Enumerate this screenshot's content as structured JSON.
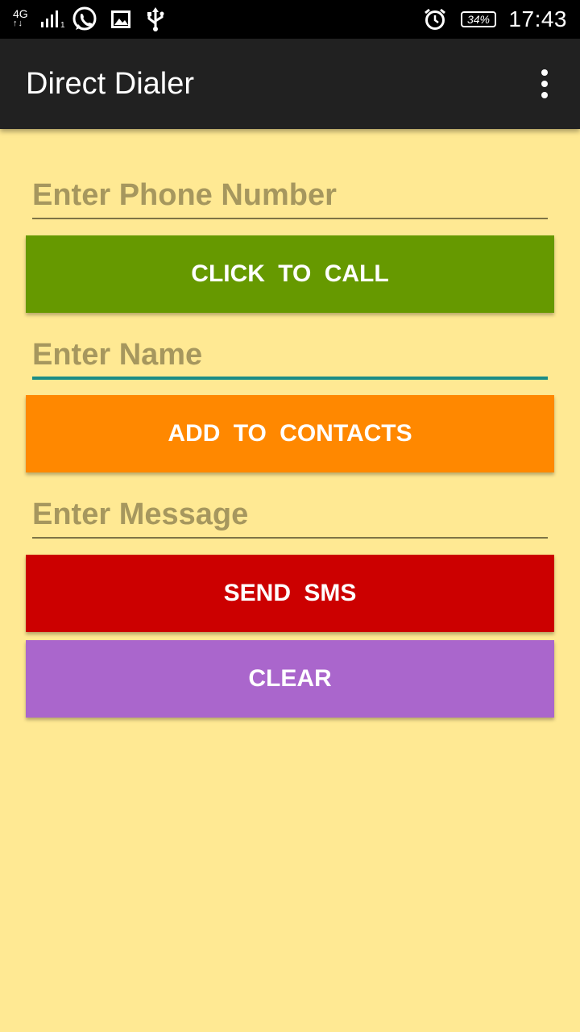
{
  "status_bar": {
    "network": "4G",
    "network_arrows": "↑↓",
    "sim_index": "1",
    "battery_percent": "34%",
    "time": "17:43"
  },
  "app_bar": {
    "title": "Direct Dialer",
    "menu_icon": "overflow-menu-icon"
  },
  "form": {
    "phone": {
      "placeholder": "Enter Phone Number",
      "value": ""
    },
    "call_button": {
      "label": "CLICK TO CALL",
      "color": "#669900"
    },
    "name": {
      "placeholder": "Enter Name",
      "value": ""
    },
    "contacts_button": {
      "label": "ADD TO CONTACTS",
      "color": "#FF8800"
    },
    "message": {
      "placeholder": "Enter Message",
      "value": ""
    },
    "sms_button": {
      "label": "SEND SMS",
      "color": "#CC0000"
    },
    "clear_button": {
      "label": "CLEAR",
      "color": "#AA66CC"
    }
  },
  "colors": {
    "background": "#FFE993",
    "app_bar": "#212121",
    "focus_underline": "#1A8C86"
  }
}
